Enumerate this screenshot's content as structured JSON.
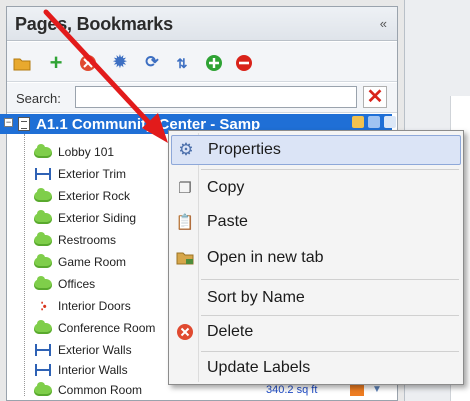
{
  "panel": {
    "title": "Pages, Bookmarks",
    "collapse_glyph": "«"
  },
  "toolbar": {
    "icons": [
      "folder-icon",
      "add-icon",
      "delete-page-icon",
      "settings-icon",
      "refresh-icon",
      "sort-icon",
      "add-circle-icon",
      "remove-circle-icon"
    ]
  },
  "search": {
    "label": "Search:",
    "value": "",
    "clear_glyph": "✕"
  },
  "tree": {
    "expander_glyph": "−",
    "page_title": "A1.1 Community Center - Samp",
    "bookmarks": [
      {
        "label": "Lobby 101",
        "icon": "cloud-icon"
      },
      {
        "label": "Exterior Trim",
        "icon": "measure-icon"
      },
      {
        "label": "Exterior Rock",
        "icon": "cloud-icon"
      },
      {
        "label": "Exterior Siding",
        "icon": "cloud-icon"
      },
      {
        "label": "Restrooms",
        "icon": "cloud-icon"
      },
      {
        "label": "Game Room",
        "icon": "cloud-icon"
      },
      {
        "label": "Offices",
        "icon": "cloud-icon"
      },
      {
        "label": "Interior Doors",
        "icon": "count-icon"
      },
      {
        "label": "Conference Room",
        "icon": "cloud-icon"
      },
      {
        "label": "Exterior Walls",
        "icon": "measure-icon"
      },
      {
        "label": "Interior Walls",
        "icon": "measure-icon"
      },
      {
        "label": "Common Room",
        "icon": "cloud-icon"
      }
    ],
    "last_measurement": "340.2 sq ft"
  },
  "context_menu": {
    "items": [
      {
        "label": "Properties",
        "icon": "gear-icon",
        "hover": true
      },
      {
        "label": "Copy",
        "icon": "copy-icon"
      },
      {
        "label": "Paste",
        "icon": "paste-icon"
      },
      {
        "label": "Open in new tab",
        "icon": "open-tab-icon"
      },
      {
        "label": "Sort by Name",
        "icon": ""
      },
      {
        "label": "Delete",
        "icon": "delete-icon"
      },
      {
        "label": "Update Labels",
        "icon": ""
      }
    ]
  },
  "colors": {
    "selection": "#1f6fd6",
    "arrow": "#e21b1b",
    "menu_hover": "#dbe4f6",
    "markup_green": "#7fce4a",
    "measure_blue": "#2f62b5"
  }
}
